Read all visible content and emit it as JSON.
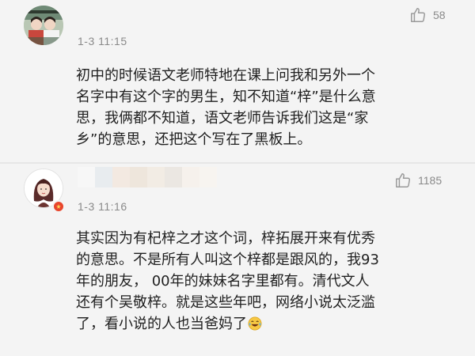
{
  "comments": [
    {
      "timestamp": "1-3 11:15",
      "likes": "58",
      "lines": [
        "初中的时候语文老师特地在课上问我和另外一个",
        "名字中有这个字的男生，知不知道“梓”是什么意",
        "思，我俩都不知道，语文老师告诉我们这是“家",
        "乡”的意思，还把这个写在了黑板上。"
      ]
    },
    {
      "timestamp": "1-3 11:16",
      "likes": "1185",
      "lines": [
        "其实因为有杞梓之才这个词，梓拓展开来有优秀",
        "的意思。不是所有人叫这个梓都是跟风的，我93",
        "年的朋友， 00年的妹妹名字里都有。清代文人",
        "还有个吴敬梓。就是这些年吧，网络小说太泛滥",
        "了，看小说的人也当爸妈了"
      ]
    }
  ],
  "icons": {
    "like": "thumbs-up-icon",
    "emoji": "laugh-cry-emoji-icon",
    "badge": "verified-badge-icon"
  },
  "colors": {
    "background": "#f4f4f4",
    "muted": "#8a8a8a",
    "badge": "#e8452c"
  }
}
